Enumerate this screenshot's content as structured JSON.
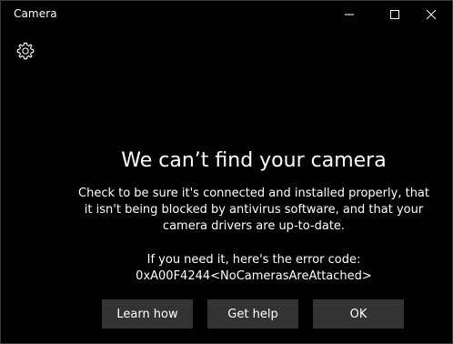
{
  "window": {
    "title": "Camera"
  },
  "icons": {
    "minimize": "minimize-icon",
    "maximize": "maximize-icon",
    "close": "close-icon",
    "settings": "gear-icon"
  },
  "error": {
    "heading": "We can’t find your camera",
    "message_lines": [
      "Check to be sure it's connected and installed properly, that",
      "it isn't being blocked by antivirus software, and that your",
      "camera drivers are up-to-date."
    ],
    "code_intro": "If you need it, here's the error code:",
    "code": "0xA00F4244<NoCamerasAreAttached>"
  },
  "buttons": {
    "learn_how": "Learn how",
    "get_help": "Get help",
    "ok": "OK"
  },
  "colors": {
    "background": "#000000",
    "text": "#ffffff",
    "button_bg": "#333333"
  }
}
